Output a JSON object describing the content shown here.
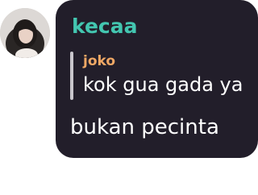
{
  "avatar": {
    "icon": "user-avatar-photo"
  },
  "message": {
    "author": "kecaa",
    "author_color": "#43c6b0",
    "reply": {
      "author": "joko",
      "author_color": "#f0a865",
      "text": "kok gua gada ya"
    },
    "text": "bukan pecinta"
  },
  "colors": {
    "bubble_background": "#221e2a",
    "text": "#ffffff",
    "reply_bar": "#c8c6cc"
  }
}
